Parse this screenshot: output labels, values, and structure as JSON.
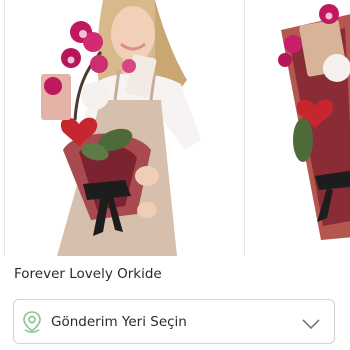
{
  "product": {
    "title": "Forever Lovely Orkide"
  },
  "delivery": {
    "select_label": "Gönderim Yeri Seçin"
  },
  "colors": {
    "pin_icon": "#8bc38e",
    "border": "#d3d3d3",
    "text": "#2b2b2b"
  },
  "icons": {
    "location": "location-pin-icon",
    "dropdown": "chevron-down-icon"
  }
}
